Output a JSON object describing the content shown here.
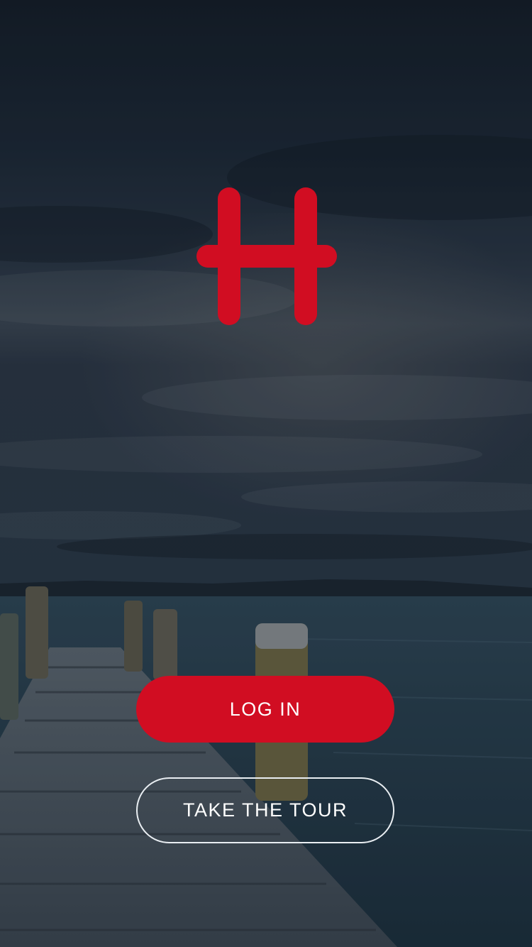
{
  "brand": {
    "logo_icon": "h-logo-icon",
    "accent_color": "#d10d22"
  },
  "background": {
    "icon": "lake-pier-photo"
  },
  "actions": {
    "login_label": "LOG IN",
    "tour_label": "TAKE THE TOUR"
  }
}
